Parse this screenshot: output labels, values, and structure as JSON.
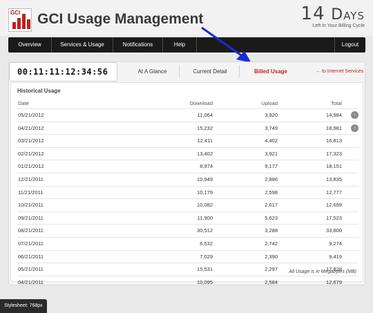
{
  "header": {
    "logo_letters": "GCI",
    "title": "GCI Usage Management",
    "days_number": "14",
    "days_word": "Days",
    "days_caption": "Left In Your Billing Cycle"
  },
  "nav": {
    "items": [
      "Overview",
      "Services & Usage",
      "Notifications",
      "Help"
    ],
    "logout": "Logout"
  },
  "timer": "00:11:11:12:34:56",
  "tabs": {
    "at_a_glance": "At A Glance",
    "current_detail": "Current Detail",
    "billed_usage": "Billed Usage",
    "to_internet": "← to Internet Services"
  },
  "usage": {
    "section_title": "Historical Usage",
    "columns": {
      "date": "Date",
      "download": "Download",
      "upload": "Upload",
      "total": "Total"
    },
    "rows": [
      {
        "date": "05/21/2012",
        "download": "11,064",
        "upload": "3,920",
        "total": "14,984",
        "detail": true
      },
      {
        "date": "04/21/2012",
        "download": "15,232",
        "upload": "3,749",
        "total": "18,981",
        "detail": true
      },
      {
        "date": "03/21/2012",
        "download": "12,411",
        "upload": "4,402",
        "total": "16,813",
        "detail": false
      },
      {
        "date": "02/21/2012",
        "download": "13,402",
        "upload": "3,921",
        "total": "17,323",
        "detail": false
      },
      {
        "date": "01/21/2012",
        "download": "8,974",
        "upload": "9,177",
        "total": "18,151",
        "detail": false
      },
      {
        "date": "12/21/2011",
        "download": "10,949",
        "upload": "2,886",
        "total": "13,835",
        "detail": false
      },
      {
        "date": "11/21/2011",
        "download": "10,179",
        "upload": "2,598",
        "total": "12,777",
        "detail": false
      },
      {
        "date": "10/21/2011",
        "download": "10,082",
        "upload": "2,617",
        "total": "12,699",
        "detail": false
      },
      {
        "date": "09/21/2011",
        "download": "11,900",
        "upload": "5,623",
        "total": "17,523",
        "detail": false
      },
      {
        "date": "08/21/2011",
        "download": "30,512",
        "upload": "3,288",
        "total": "33,800",
        "detail": false
      },
      {
        "date": "07/21/2011",
        "download": "6,532",
        "upload": "2,742",
        "total": "9,274",
        "detail": false
      },
      {
        "date": "06/21/2011",
        "download": "7,029",
        "upload": "2,390",
        "total": "9,419",
        "detail": false
      },
      {
        "date": "05/21/2011",
        "download": "15,531",
        "upload": "2,297",
        "total": "17,828",
        "detail": false
      },
      {
        "date": "04/21/2011",
        "download": "10,095",
        "upload": "2,584",
        "total": "12,679",
        "detail": false
      }
    ],
    "footnote": "All Usage is in Megabytes (MB)"
  },
  "stylesheet_label": "Stylesheet: 768px",
  "colors": {
    "accent_red": "#c0211f",
    "arrow_blue": "#1a2bd6",
    "nav_bg": "#1a1a1a"
  },
  "icons": {
    "detail": "chevron-right-icon",
    "annotation": "arrow-icon"
  }
}
